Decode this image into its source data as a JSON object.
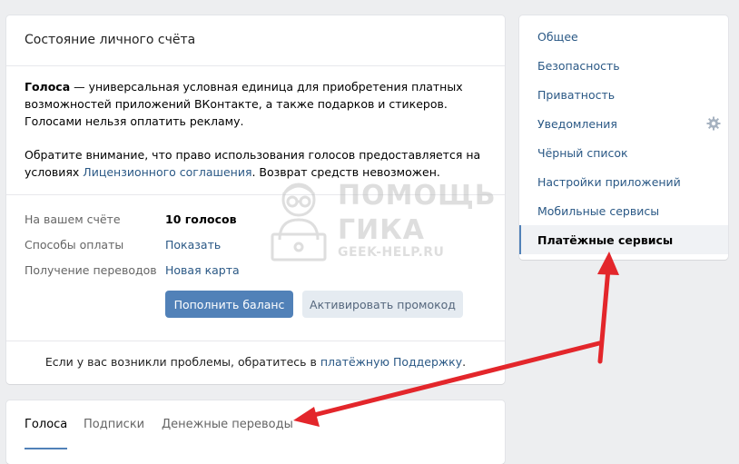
{
  "main": {
    "title": "Состояние личного счёта",
    "desc1_bold": "Голоса",
    "desc1_rest": " — универсальная условная единица для приобретения платных возможностей приложений ВКонтакте, а также подарков и стикеров. Голосами нельзя оплатить рекламу.",
    "desc2_pre": "Обратите внимание, что право использования голосов предоставляется на условиях ",
    "desc2_link": "Лицензионного соглашения",
    "desc2_post": ". Возврат средств невозможен.",
    "rows": [
      {
        "label": "На вашем счёте",
        "value": "10 голосов"
      },
      {
        "label": "Способы оплаты",
        "value": "Показать"
      },
      {
        "label": "Получение переводов",
        "value": "Новая карта"
      }
    ],
    "topup_button": "Пополнить баланс",
    "promo_button": "Активировать промокод",
    "footer_pre": "Если у вас возникли проблемы, обратитесь в ",
    "footer_link": "платёжную Поддержку",
    "footer_post": "."
  },
  "tabs": [
    {
      "label": "Голоса",
      "active": true
    },
    {
      "label": "Подписки",
      "active": false
    },
    {
      "label": "Денежные переводы",
      "active": false
    }
  ],
  "sidebar": {
    "items": [
      {
        "label": "Общее"
      },
      {
        "label": "Безопасность"
      },
      {
        "label": "Приватность"
      },
      {
        "label": "Уведомления"
      },
      {
        "label": "Чёрный список"
      },
      {
        "label": "Настройки приложений"
      },
      {
        "label": "Мобильные сервисы"
      },
      {
        "label": "Платёжные сервисы",
        "active": true
      }
    ]
  },
  "watermark": {
    "line1": "ПОМОЩЬ",
    "line2": "ГИКА",
    "line3": "GEEK-HELP.RU"
  },
  "colors": {
    "accent": "#5181b8",
    "link": "#2a5885",
    "arrow": "#e3262b",
    "background": "#edeef0"
  },
  "icons": [
    "gear-icon",
    "mascot-icon",
    "arrow-icon"
  ]
}
